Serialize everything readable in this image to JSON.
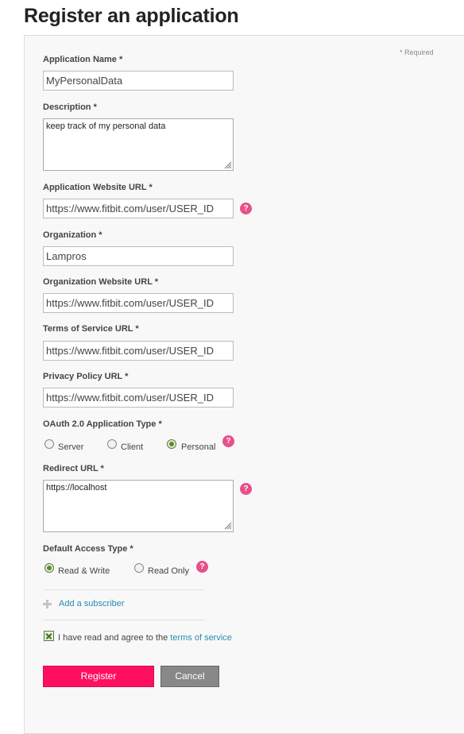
{
  "page": {
    "title": "Register an application",
    "required_note": "* Required"
  },
  "form": {
    "app_name": {
      "label": "Application Name *",
      "value": "MyPersonalData"
    },
    "description": {
      "label": "Description *",
      "value": "keep track of my personal data"
    },
    "website_url": {
      "label": "Application Website URL *",
      "value": "https://www.fitbit.com/user/USER_ID"
    },
    "organization": {
      "label": "Organization *",
      "value": "Lampros"
    },
    "org_website_url": {
      "label": "Organization Website URL *",
      "value": "https://www.fitbit.com/user/USER_ID"
    },
    "tos_url": {
      "label": "Terms of Service URL *",
      "value": "https://www.fitbit.com/user/USER_ID"
    },
    "privacy_url": {
      "label": "Privacy Policy URL *",
      "value": "https://www.fitbit.com/user/USER_ID"
    },
    "oauth_type": {
      "label": "OAuth 2.0 Application Type *",
      "options": [
        "Server",
        "Client",
        "Personal"
      ],
      "selected": "Personal"
    },
    "redirect_url": {
      "label": "Redirect URL *",
      "value": "https://localhost"
    },
    "access_type": {
      "label": "Default Access Type *",
      "options": [
        "Read & Write",
        "Read Only"
      ],
      "selected": "Read & Write"
    },
    "add_subscriber": "Add a subscriber",
    "agree": {
      "text": "I have read and agree to the",
      "link": "terms of service",
      "checked": true
    },
    "register_label": "Register",
    "cancel_label": "Cancel",
    "help_symbol": "?"
  },
  "colors": {
    "accent": "#ff0f5f",
    "link": "#2a8bb2",
    "help": "#e8508a",
    "cancel": "#888888"
  }
}
